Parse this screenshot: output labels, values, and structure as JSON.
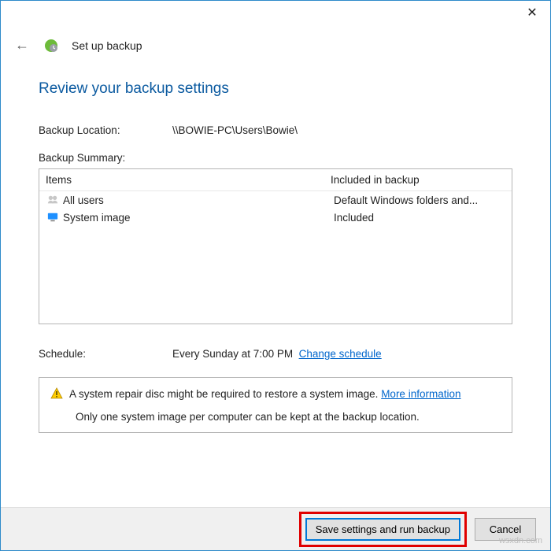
{
  "titlebar": {
    "close_glyph": "✕"
  },
  "header": {
    "back_glyph": "←",
    "wizard_label": "Set up backup"
  },
  "page": {
    "heading": "Review your backup settings",
    "location_label": "Backup Location:",
    "location_value": "\\\\BOWIE-PC\\Users\\Bowie\\",
    "summary_label": "Backup Summary:",
    "col_items": "Items",
    "col_included": "Included in backup",
    "rows": [
      {
        "icon": "users",
        "item": "All users",
        "included": "Default Windows folders and..."
      },
      {
        "icon": "monitor",
        "item": "System image",
        "included": "Included"
      }
    ],
    "schedule_label": "Schedule:",
    "schedule_value": "Every Sunday at 7:00 PM",
    "schedule_link": "Change schedule"
  },
  "note": {
    "line1_text": "A system repair disc might be required to restore a system image.",
    "line1_link": "More information",
    "line2": "Only one system image per computer can be kept at the backup location."
  },
  "footer": {
    "primary": "Save settings and run backup",
    "cancel": "Cancel"
  },
  "watermark": "wsxdn.com"
}
